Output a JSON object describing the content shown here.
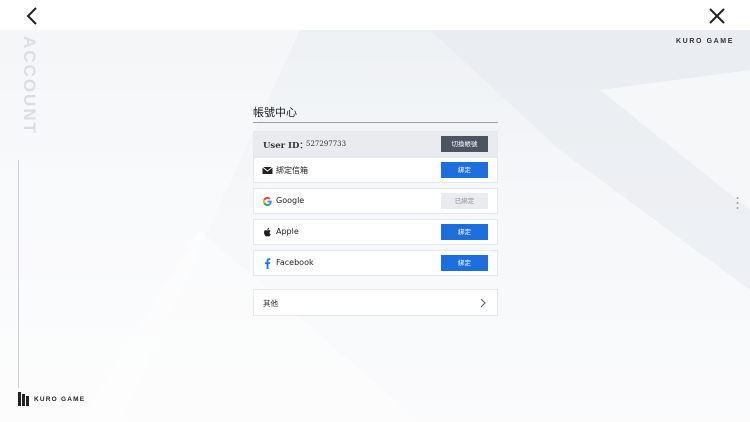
{
  "header": {
    "back_icon": "chevron-left-icon",
    "close_icon": "close-icon"
  },
  "branding": {
    "top_logo": "KURO GAME",
    "bottom_logo": "KURO GAME",
    "side_watermark": "ACCOUNT"
  },
  "panel": {
    "title": "帳號中心",
    "user_id": {
      "label": "User ID：",
      "value": "527297733",
      "button": "切換帳號"
    },
    "bindings": [
      {
        "icon": "mail-icon",
        "label": "綁定信箱",
        "button": "綁定",
        "state": "unbound"
      },
      {
        "icon": "google-icon",
        "label": "Google",
        "button": "已綁定",
        "state": "bound"
      },
      {
        "icon": "apple-icon",
        "label": "Apple",
        "button": "綁定",
        "state": "unbound"
      },
      {
        "icon": "facebook-icon",
        "label": "Facebook",
        "button": "綁定",
        "state": "unbound"
      }
    ],
    "more": {
      "label": "其他",
      "icon": "chevron-right-icon"
    }
  },
  "colors": {
    "accent_blue": "#1e6fde",
    "switch_button": "#4a5462",
    "bound_button": "#e9ebee"
  }
}
